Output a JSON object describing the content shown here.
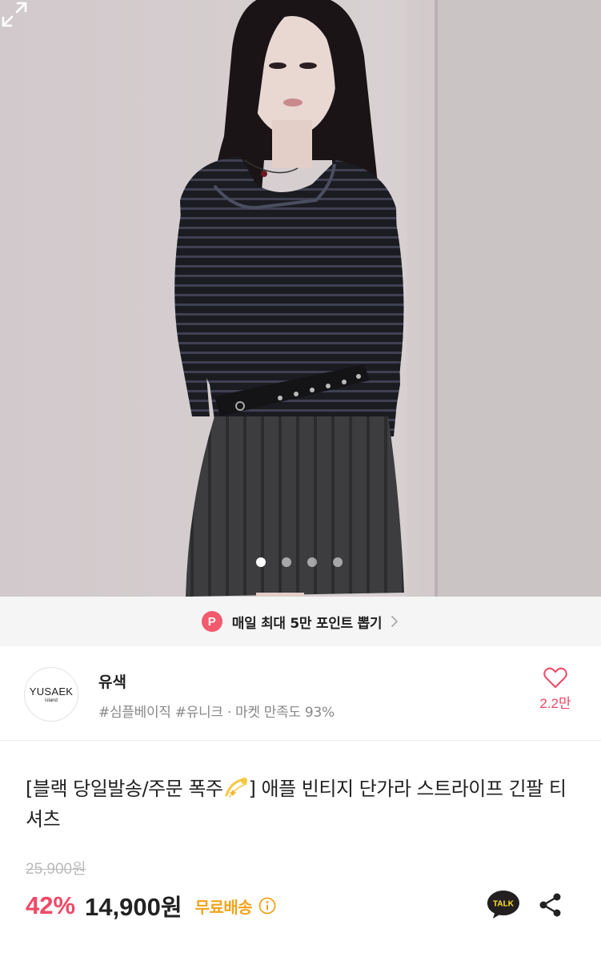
{
  "carousel": {
    "total": 4,
    "active_index": 0,
    "image_icon": "model-photo",
    "expand_icon": "expand-icon"
  },
  "point_banner": {
    "badge": "P",
    "text": "매일 최대 5만 포인트 뽑기",
    "badge_color": "#f25a6e"
  },
  "shop": {
    "logo_text": "YUSAEK",
    "logo_subtext": "island",
    "name": "유색",
    "tags": "#심플베이직 #유니크 · 마켓 만족도 93%",
    "likes": "2.2만",
    "accent_color": "#f04866"
  },
  "product": {
    "title_part1": "[블랙 당일발송/주문 폭주",
    "title_part2": "] 애플 빈티지 단가라 스트라이프 긴팔 티셔츠",
    "original_price": "25,900원",
    "discount": "42%",
    "price": "14,900",
    "price_unit": "원",
    "shipping": "무료배송",
    "shipping_color": "#f2a31b",
    "talk_label": "TALK"
  }
}
